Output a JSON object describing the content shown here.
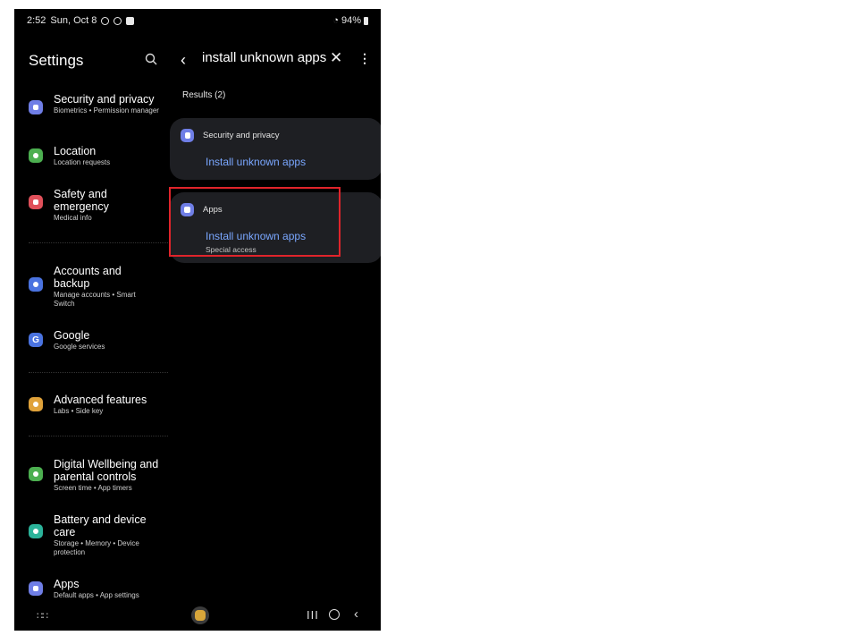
{
  "status_bar": {
    "time": "2:52",
    "date": "Sun, Oct 8",
    "battery": "94%"
  },
  "sidebar": {
    "title": "Settings",
    "items": [
      {
        "title": "Security and privacy",
        "subtitle": "Biometrics • Permission manager",
        "color": "#6f7ee6"
      },
      {
        "title": "Location",
        "subtitle": "Location requests",
        "color": "#4caf50"
      },
      {
        "title": "Safety and emergency",
        "subtitle": "Medical info",
        "color": "#e0505a"
      },
      {
        "title": "Accounts and backup",
        "subtitle": "Manage accounts • Smart Switch",
        "color": "#4a73e0"
      },
      {
        "title": "Google",
        "subtitle": "Google services",
        "color": "#4a73e0"
      },
      {
        "title": "Advanced features",
        "subtitle": "Labs • Side key",
        "color": "#e0a23a"
      },
      {
        "title": "Digital Wellbeing and parental controls",
        "subtitle": "Screen time • App timers",
        "color": "#4caf50"
      },
      {
        "title": "Battery and device care",
        "subtitle": "Storage • Memory • Device protection",
        "color": "#2bb39a"
      },
      {
        "title": "Apps",
        "subtitle": "Default apps • App settings",
        "color": "#6f7ee6"
      }
    ]
  },
  "search": {
    "value": "install unknown apps"
  },
  "results": {
    "label": "Results (2)",
    "cards": [
      {
        "category": "Security and privacy",
        "link": "Install unknown apps",
        "subtitle": ""
      },
      {
        "category": "Apps",
        "link": "Install unknown apps",
        "subtitle": "Special access"
      }
    ]
  },
  "colors": {
    "accent_link": "#7aa7ff",
    "highlight": "#e0242b",
    "card_bg": "#1e1f23"
  }
}
